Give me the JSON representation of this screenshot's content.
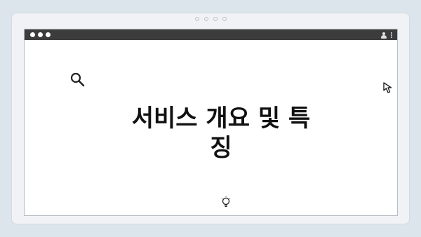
{
  "window": {
    "title_dots": 3
  },
  "main": {
    "title": "서비스 개요 및 특징"
  },
  "icons": {
    "search": "search-icon",
    "cursor": "cursor-icon",
    "idea": "lightbulb-icon",
    "user": "user-icon",
    "menu": "kebab-menu-icon"
  },
  "colors": {
    "background": "#dce4ec",
    "titlebar": "#3c3c3c",
    "window": "#ffffff",
    "text": "#111111"
  }
}
